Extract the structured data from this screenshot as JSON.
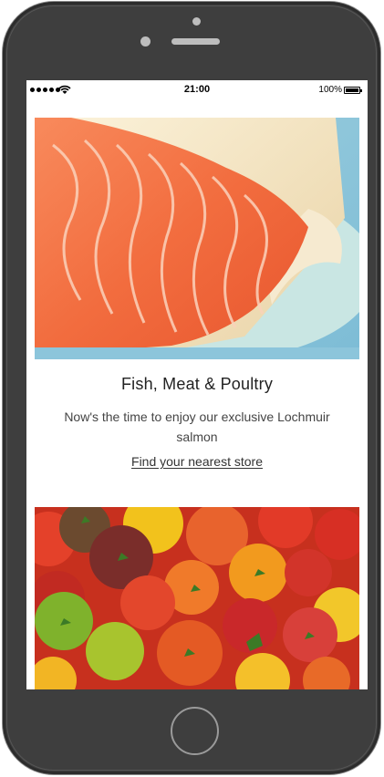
{
  "status_bar": {
    "time": "21:00",
    "battery": "100%"
  },
  "promo": {
    "title": "Fish, Meat & Poultry",
    "description": "Now's the time to enjoy our exclusive Lochmuir salmon",
    "link_label": "Find your nearest store"
  },
  "images": {
    "hero": "salmon-fillet-photo",
    "secondary": "heirloom-tomatoes-photo"
  }
}
